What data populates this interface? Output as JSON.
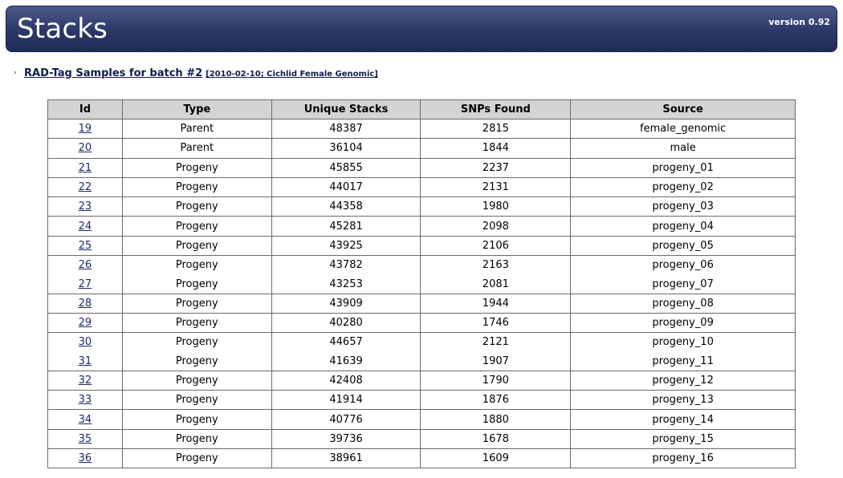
{
  "header": {
    "logo": "Stacks",
    "version": "version 0.92"
  },
  "batch": {
    "chevron": "›",
    "title": "RAD-Tag Samples for batch #2",
    "subtitle": "[2010-02-10; Cichlid Female Genomic]"
  },
  "table": {
    "columns": [
      "Id",
      "Type",
      "Unique Stacks",
      "SNPs Found",
      "Source"
    ],
    "rows": [
      {
        "id": "19",
        "type": "Parent",
        "unique_stacks": "48387",
        "snps": "2815",
        "source": "female_genomic"
      },
      {
        "id": "20",
        "type": "Parent",
        "unique_stacks": "36104",
        "snps": "1844",
        "source": "male"
      },
      {
        "id": "21",
        "type": "Progeny",
        "unique_stacks": "45855",
        "snps": "2237",
        "source": "progeny_01"
      },
      {
        "id": "22",
        "type": "Progeny",
        "unique_stacks": "44017",
        "snps": "2131",
        "source": "progeny_02"
      },
      {
        "id": "23",
        "type": "Progeny",
        "unique_stacks": "44358",
        "snps": "1980",
        "source": "progeny_03"
      },
      {
        "id": "24",
        "type": "Progeny",
        "unique_stacks": "45281",
        "snps": "2098",
        "source": "progeny_04"
      },
      {
        "id": "25",
        "type": "Progeny",
        "unique_stacks": "43925",
        "snps": "2106",
        "source": "progeny_05"
      },
      {
        "id": "26",
        "type": "Progeny",
        "unique_stacks": "43782",
        "snps": "2163",
        "source": "progeny_06"
      },
      {
        "id": "27",
        "type": "Progeny",
        "unique_stacks": "43253",
        "snps": "2081",
        "source": "progeny_07"
      },
      {
        "id": "28",
        "type": "Progeny",
        "unique_stacks": "43909",
        "snps": "1944",
        "source": "progeny_08"
      },
      {
        "id": "29",
        "type": "Progeny",
        "unique_stacks": "40280",
        "snps": "1746",
        "source": "progeny_09"
      },
      {
        "id": "30",
        "type": "Progeny",
        "unique_stacks": "44657",
        "snps": "2121",
        "source": "progeny_10"
      },
      {
        "id": "31",
        "type": "Progeny",
        "unique_stacks": "41639",
        "snps": "1907",
        "source": "progeny_11"
      },
      {
        "id": "32",
        "type": "Progeny",
        "unique_stacks": "42408",
        "snps": "1790",
        "source": "progeny_12"
      },
      {
        "id": "33",
        "type": "Progeny",
        "unique_stacks": "41914",
        "snps": "1876",
        "source": "progeny_13"
      },
      {
        "id": "34",
        "type": "Progeny",
        "unique_stacks": "40776",
        "snps": "1880",
        "source": "progeny_14"
      },
      {
        "id": "35",
        "type": "Progeny",
        "unique_stacks": "39736",
        "snps": "1678",
        "source": "progeny_15"
      },
      {
        "id": "36",
        "type": "Progeny",
        "unique_stacks": "38961",
        "snps": "1609",
        "source": "progeny_16"
      }
    ]
  },
  "colors": {
    "header_bg": "#2c3868",
    "link": "#1b2a6b",
    "table_header_bg": "#d4d4d4"
  }
}
